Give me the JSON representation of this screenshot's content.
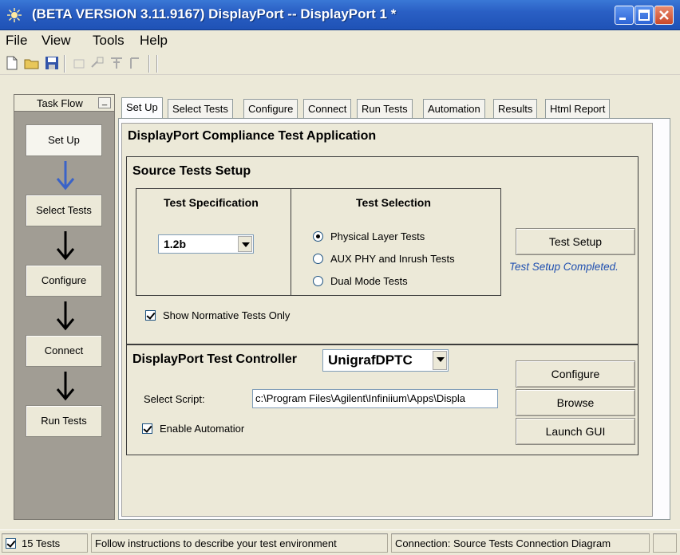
{
  "window": {
    "title": "(BETA VERSION 3.11.9167) DisplayPort -- DisplayPort 1 *"
  },
  "menu": [
    "File",
    "View",
    "Tools",
    "Help"
  ],
  "taskflow": {
    "header": "Task Flow",
    "minimize": "_",
    "steps": [
      "Set Up",
      "Select Tests",
      "Configure",
      "Connect",
      "Run Tests"
    ]
  },
  "tabs": [
    "Set Up",
    "Select Tests",
    "Configure",
    "Connect",
    "Run Tests",
    "Automation",
    "Results",
    "Html Report"
  ],
  "main": {
    "app_title": "DisplayPort Compliance Test Application",
    "source_setup": {
      "title": "Source Tests Setup",
      "test_spec_label": "Test Specification",
      "test_spec_value": "1.2b",
      "test_selection_label": "Test Selection",
      "options": [
        "Physical Layer Tests",
        "AUX PHY and Inrush Tests",
        "Dual Mode Tests"
      ],
      "selected_option": "Physical Layer Tests",
      "test_setup_button": "Test Setup",
      "test_setup_status": "Test Setup Completed.",
      "show_normative_label": "Show Normative Tests Only",
      "show_normative_checked": true
    },
    "controller": {
      "title": "DisplayPort Test Controller",
      "controller_value": "UnigrafDPTC",
      "select_script_label": "Select Script:",
      "script_path": "c:\\Program Files\\Agilent\\Infiniium\\Apps\\Displa",
      "enable_automation_label": "Enable Automatior",
      "enable_automation_checked": true,
      "configure_button": "Configure",
      "browse_button": "Browse",
      "launch_gui_button": "Launch GUI"
    }
  },
  "status": {
    "tests_count": "15 Tests",
    "tests_checked": true,
    "message": "Follow instructions to describe your test environment",
    "connection": "Connection: Source Tests Connection Diagram"
  },
  "colors": {
    "titlebar": "#2a5fc4",
    "flow_arrow_active": "#3a63c8",
    "status_text": "#1f4fb0",
    "panel_bg": "#ece9d8"
  }
}
